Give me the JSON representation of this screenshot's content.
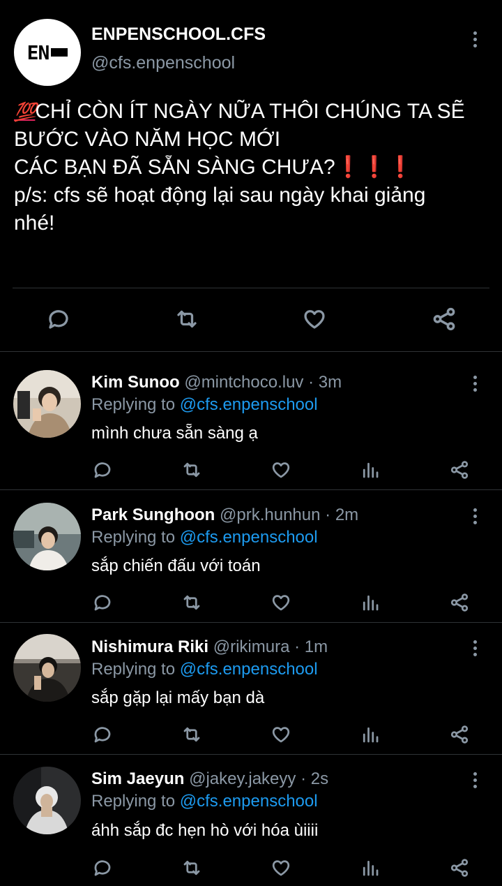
{
  "post": {
    "name": "ENPENSCHOOL.CFS",
    "handle": "@cfs.enpenschool",
    "avatar_text": "EN",
    "emoji_100": "💯",
    "line1": "CHỈ CÒN ÍT NGÀY NỮA THÔI CHÚNG TA SẼ",
    "line2": "BƯỚC VÀO NĂM HỌC MỚI",
    "line3": "CÁC BẠN ĐÃ SẴN SÀNG CHƯA?",
    "bangs": "❗❗❗",
    "line4": "p/s: cfs sẽ hoạt động lại sau ngày khai giảng",
    "line5": "nhé!"
  },
  "icons": {
    "reply": "reply-icon",
    "retweet": "retweet-icon",
    "like": "heart-icon",
    "views": "views-icon",
    "share": "share-icon",
    "more": "more-options-icon"
  },
  "colors": {
    "background": "#000000",
    "muted": "#8b98a5",
    "link": "#1d9bf0",
    "divider": "#2f3336"
  },
  "replies": [
    {
      "name": "Kim Sunoo",
      "handle": "@mintchoco.luv",
      "time": "3m",
      "replying_prefix": "Replying to",
      "replying_to": "@cfs.enpenschool",
      "text": "mình chưa sẵn sàng ạ"
    },
    {
      "name": "Park Sunghoon",
      "handle": "@prk.hunhun",
      "time": "2m",
      "replying_prefix": "Replying to",
      "replying_to": "@cfs.enpenschool",
      "text": "sắp chiến đấu với toán"
    },
    {
      "name": "Nishimura Riki",
      "handle": "@rikimura",
      "time": "1m",
      "replying_prefix": "Replying to",
      "replying_to": "@cfs.enpenschool",
      "text": "sắp gặp lại mấy bạn dà"
    },
    {
      "name": "Sim Jaeyun",
      "handle": "@jakey.jakeyy",
      "time": "2s",
      "replying_prefix": "Replying to",
      "replying_to": "@cfs.enpenschool",
      "text": "áhh sắp đc hẹn hò với hóa ùiiii"
    }
  ]
}
